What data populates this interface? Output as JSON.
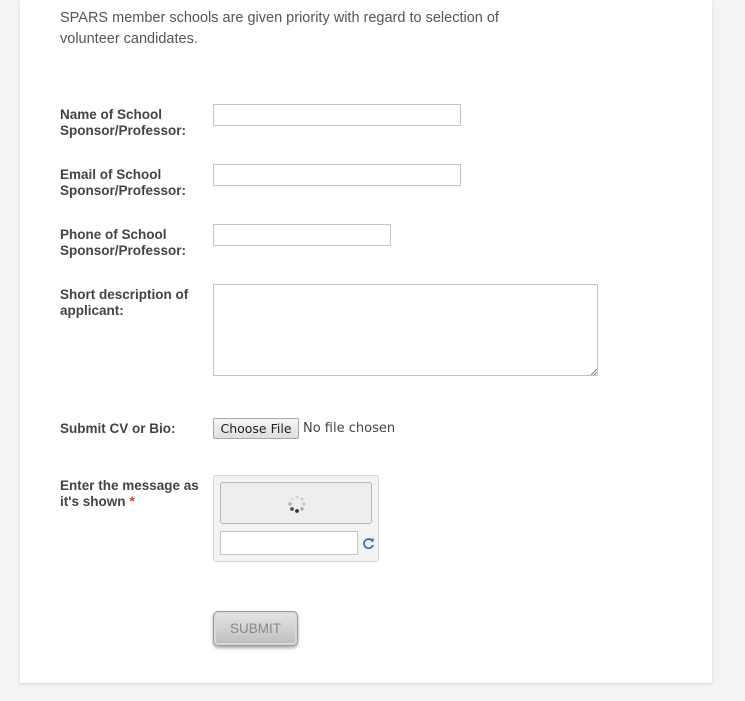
{
  "intro": {
    "text": "SPARS member schools are given priority with regard to selection of volunteer candidates."
  },
  "form": {
    "sponsor_name": {
      "label_line1": "Name of School",
      "label_line2": "Sponsor/Professor:",
      "value": ""
    },
    "sponsor_email": {
      "label_line1": "Email of School",
      "label_line2": "Sponsor/Professor:",
      "value": ""
    },
    "sponsor_phone": {
      "label_line1": "Phone of School",
      "label_line2": "Sponsor/Professor:",
      "value": ""
    },
    "description": {
      "label_line1": "Short description of",
      "label_line2": "applicant:",
      "value": ""
    },
    "cv_upload": {
      "label": "Submit CV or Bio:",
      "button_label": "Choose File",
      "status": "No file chosen"
    },
    "captcha": {
      "label_line1": "Enter the message as",
      "label_line2": "it's shown",
      "required_marker": "*",
      "value": ""
    },
    "submit_label": "SUBMIT"
  },
  "colors": {
    "page_background": "#f4f4f4",
    "card_background": "#ffffff",
    "label_text": "#444444",
    "required_marker": "#d24040",
    "refresh_icon": "#3f6fb5"
  },
  "icons": {
    "captcha_loading": "loading-spinner-icon",
    "captcha_refresh": "refresh-icon",
    "textarea_resize": "resize-grip-icon"
  }
}
